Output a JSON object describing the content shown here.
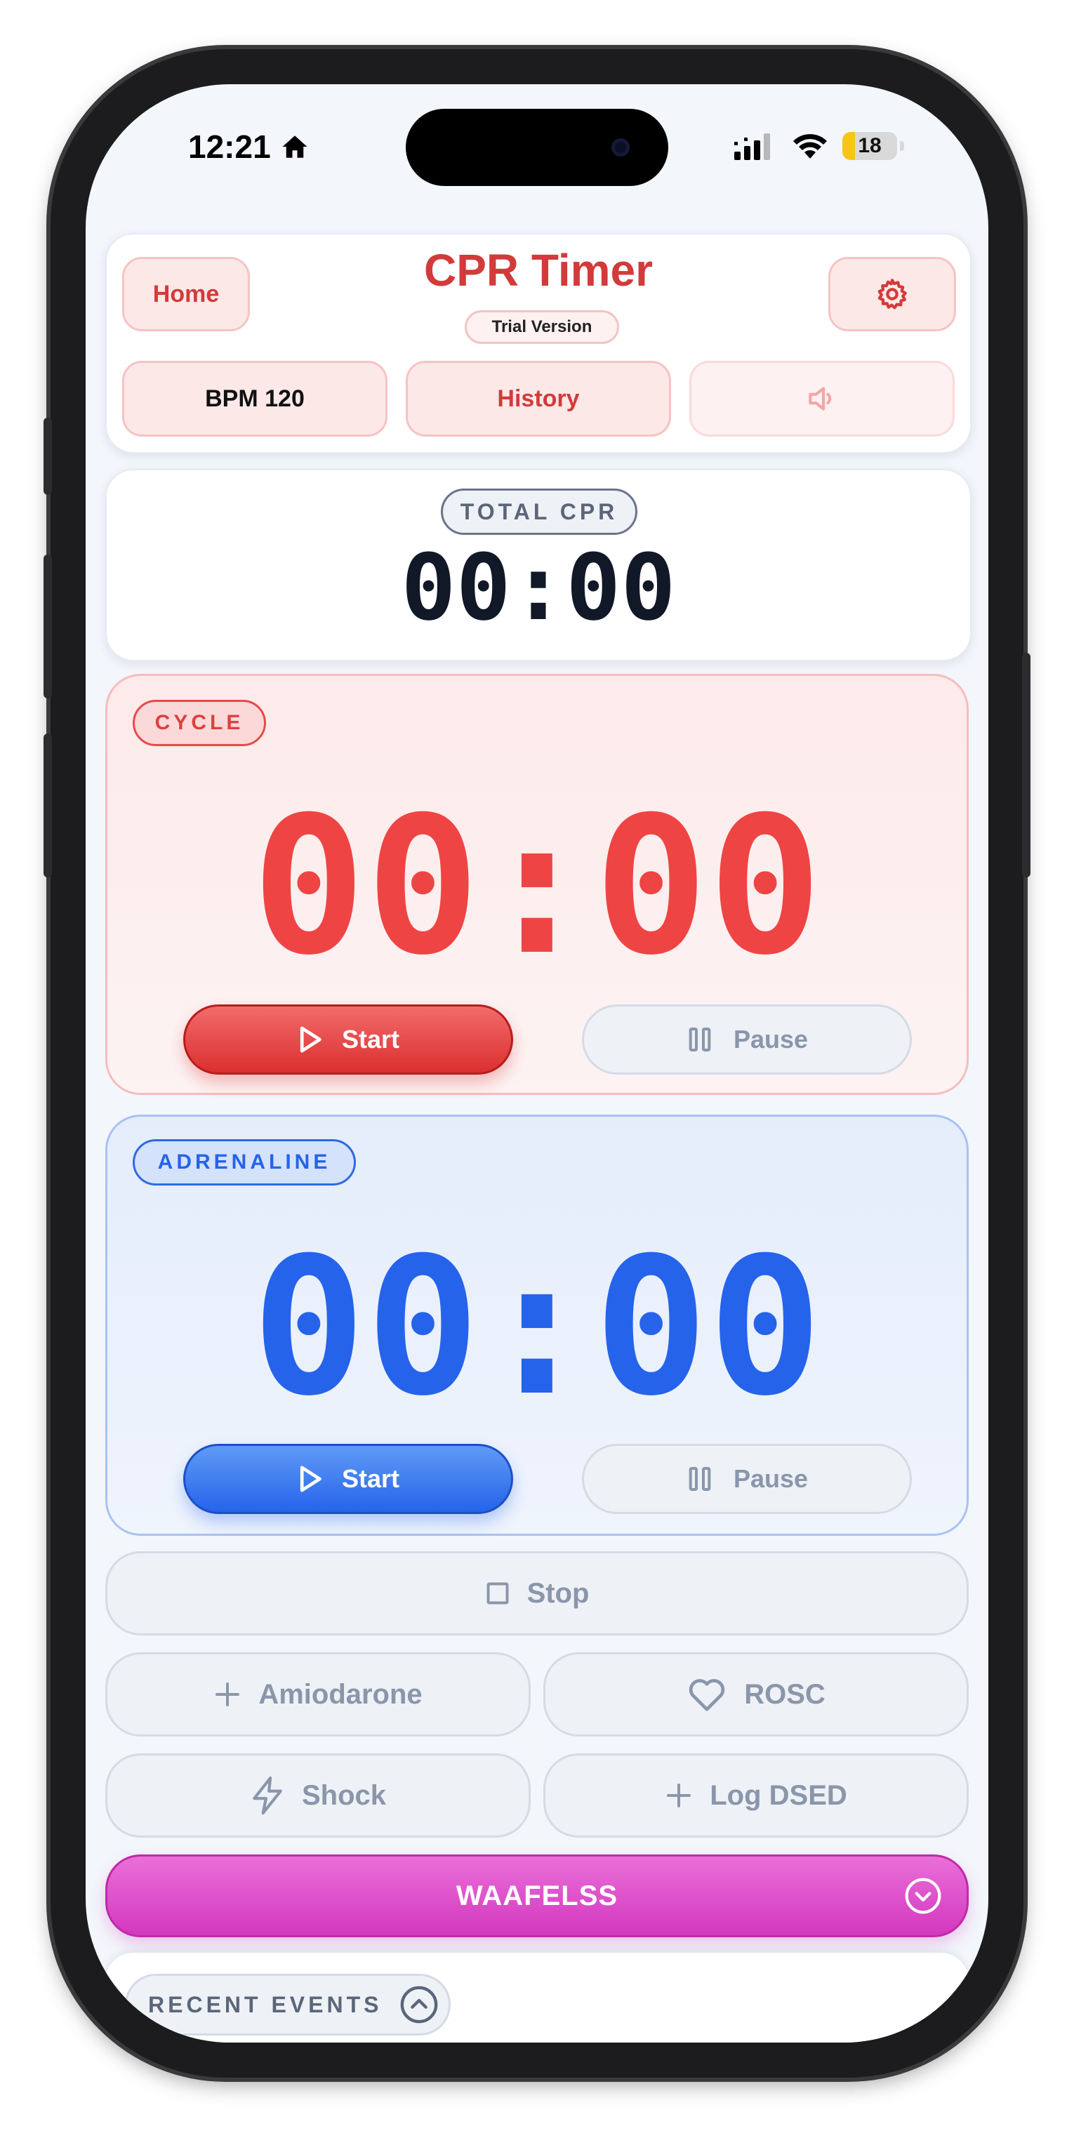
{
  "status_bar": {
    "time": "12:21",
    "battery": "18"
  },
  "header": {
    "title": "CPR Timer",
    "badge": "Trial Version",
    "home_label": "Home",
    "bpm_label": "BPM 120",
    "history_label": "History"
  },
  "total_cpr": {
    "label": "TOTAL CPR",
    "time": "00:00"
  },
  "cycle": {
    "label": "CYCLE",
    "time": "00:00",
    "start_label": "Start",
    "pause_label": "Pause",
    "accent": "#ef4444"
  },
  "adrenaline": {
    "label": "ADRENALINE",
    "time": "00:00",
    "start_label": "Start",
    "pause_label": "Pause",
    "accent": "#2563eb"
  },
  "actions": {
    "stop_label": "Stop",
    "amiodarone_label": "Amiodarone",
    "rosc_label": "ROSC",
    "shock_label": "Shock",
    "log_dsed_label": "Log DSED"
  },
  "waafelss": {
    "label": "WAAFELSS",
    "color": "#d946c4"
  },
  "recent_events": {
    "label": "RECENT EVENTS"
  }
}
